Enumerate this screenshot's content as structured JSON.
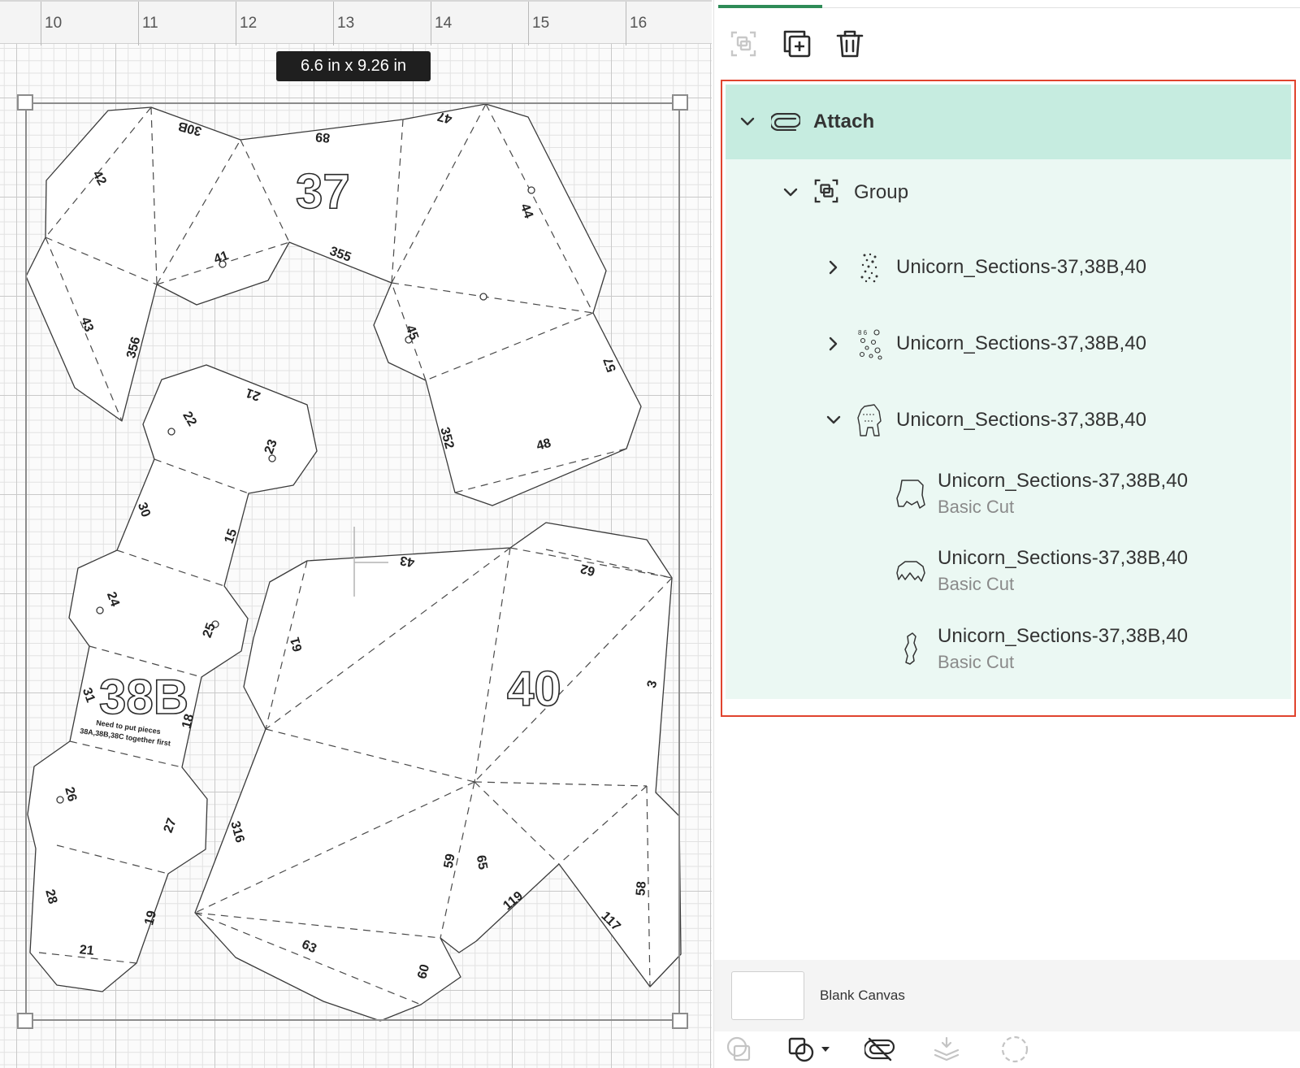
{
  "canvas": {
    "ruler_labels": [
      "10",
      "11",
      "12",
      "13",
      "14",
      "15",
      "16"
    ],
    "dimension_badge": "6.6  in x 9.26  in",
    "piece_labels": {
      "p37": "37",
      "p38b": "38B",
      "p40": "40",
      "note_line1": "Need to put pieces",
      "note_line2": "38A,38B,38C together first"
    },
    "tab_numbers": [
      "30B",
      "42",
      "89",
      "47",
      "44",
      "41",
      "355",
      "43",
      "356",
      "45",
      "57",
      "352",
      "48",
      "22",
      "21",
      "23",
      "30",
      "15",
      "24",
      "25",
      "31",
      "18",
      "26",
      "27",
      "28",
      "19",
      "21",
      "43",
      "62",
      "61",
      "3",
      "316",
      "59",
      "65",
      "119",
      "58",
      "117",
      "63",
      "60"
    ]
  },
  "panel": {
    "top_toolbar": {
      "group_icon": "group-icon",
      "duplicate_icon": "duplicate-icon",
      "delete_icon": "trash-icon"
    },
    "layers": {
      "attach": {
        "label": "Attach",
        "icon": "paperclip-icon",
        "expanded": true
      },
      "group": {
        "label": "Group",
        "icon": "group-icon",
        "expanded": true
      },
      "children": [
        {
          "label": "Unicorn_Sections-37,38B,40",
          "expanded": false
        },
        {
          "label": "Unicorn_Sections-37,38B,40",
          "expanded": false
        },
        {
          "label": "Unicorn_Sections-37,38B,40",
          "expanded": true
        }
      ],
      "leaves": [
        {
          "label": "Unicorn_Sections-37,38B,40",
          "sublabel": "Basic Cut"
        },
        {
          "label": "Unicorn_Sections-37,38B,40",
          "sublabel": "Basic Cut"
        },
        {
          "label": "Unicorn_Sections-37,38B,40",
          "sublabel": "Basic Cut"
        }
      ]
    },
    "blank_canvas": {
      "label": "Blank Canvas"
    },
    "bottom_toolbar": [
      "slice-icon",
      "combine-icon",
      "detach-icon",
      "flatten-icon",
      "contour-icon"
    ]
  },
  "colors": {
    "accent": "#2e8b57",
    "attach_highlight": "#c6ece0",
    "group_highlight": "#ebf8f3",
    "selection_outline": "#e0442e"
  }
}
